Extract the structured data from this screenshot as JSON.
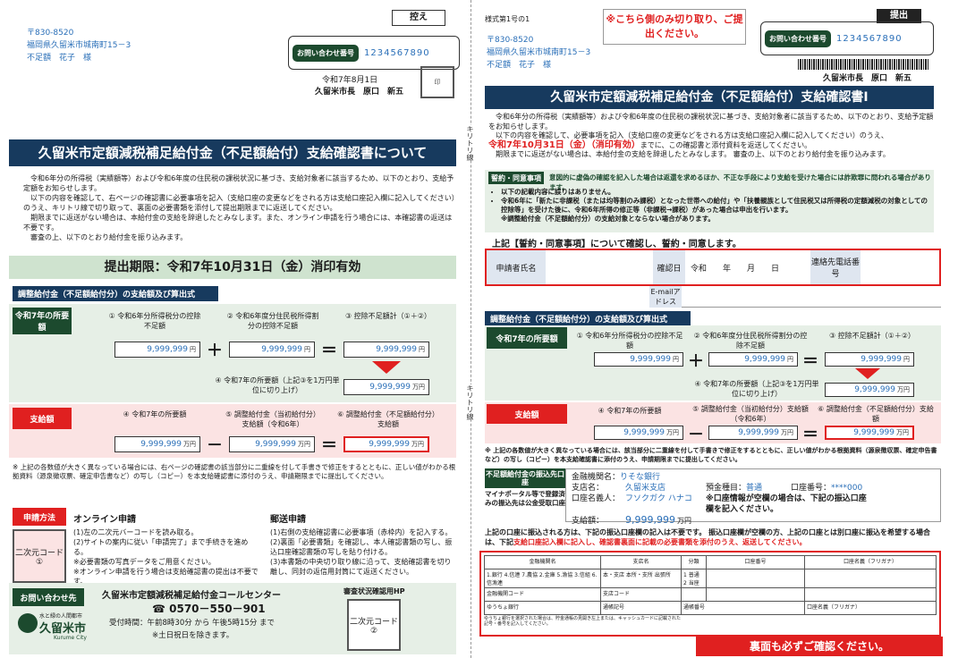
{
  "left": {
    "keep_label": "控え",
    "address": [
      "〒830-8520",
      "福岡県久留米市城南町15－3",
      "不足額　花子　様"
    ],
    "contact_label": "お問い合わせ番号",
    "contact_number": "1234567890",
    "date": "令和7年8月1日",
    "mayor": "久留米市長　原口　新五",
    "title": "久留米市定額減税補足給付金（不足額給付）支給確認書について",
    "intro": [
      "令和6年分の所得税（実績額等）および令和6年度の住民税の課税状況に基づき、支給対象者に該当するため、以下のとおり、支給予定額をお知らせします。",
      "以下の内容を確認して、右ページの確認書に必要事項を記入（支給口座の変更などをされる方は支給口座記入欄に記入してください）のうえ、キリトリ線で切り取って、裏面の必要書類を添付して提出期限までに返送してください。",
      "期限までに返送がない場合は、本給付金の支給を辞退したとみなします。また、オンライン申請を行う場合には、本確認書の返送は不要です。",
      "審査の上、以下のとおり給付金を振り込みます。"
    ],
    "deadline": "提出期限：令和7年10月31日（金）消印有効",
    "calc_heading": "調整給付金（不足額給付分）の支給額及び算出式",
    "row1_label": "令和7年の所要額",
    "c1": "① 令和6年分所得税分の控除不足額",
    "c2": "② 令和6年度分住民税所得割分の控除不足額",
    "c3": "③ 控除不足額計（①＋②）",
    "v1": "9,999,999",
    "v2": "9,999,999",
    "v3": "9,999,999",
    "unit_yen": "円",
    "unit_man": "万円",
    "c4": "④ 令和7年の所要額（上記③を1万円単位に切り上げ）",
    "v4": "9,999,999",
    "row2_label": "支給額",
    "c5": "④ 令和7年の所要額",
    "c6": "⑤ 調整給付金（当初給付分）支給額（令和6年）",
    "c7": "⑥ 調整給付金（不足額給付分）支給額",
    "v5": "9,999,999",
    "v6": "9,999,999",
    "v7": "9,999,999",
    "note": "※ 上記の各数値が大きく異なっている場合には、右ページの確認書の該当部分に二重線を付して手書きで修正をするとともに、正しい値がわかる根拠資料（源泉徴収票、確定申告書など）の写し（コピー）を本支給確認書に添付のうえ、申請期限までに提出してください。",
    "method_label": "申請方法",
    "online_title": "オンライン申請",
    "online_steps": [
      "(1)左の二次元バーコードを読み取る。",
      "(2)サイトの案内に従い「申請完了」まで手続きを進める。",
      "※必要書類の写真データをご用意ください。",
      "※オンライン申請を行う場合は支給確認書の提出は不要です。"
    ],
    "mail_title": "郵送申請",
    "mail_steps": [
      "(1)右側の支給確認書に必要事項（赤枠内）を記入する。",
      "(2)裏面「必要書類」を確認し、本人確認書類の写し、振込口座確認書類の写しを貼り付ける。",
      "(3)本書類の中央切り取り線に沿って、支給確認書を切り離し、同封の返信用封筒にて返送ください。"
    ],
    "qr1": "二次元コード①",
    "inquiry_label": "お問い合わせ先",
    "call_center": "久留米市定額減税補足給付金コールセンター",
    "phone": "☎ 0570－550－901",
    "hours": "受付時間：午前8時30分 から 午後5時15分 まで",
    "holidays": "※土日祝日を除きます。",
    "hp_label": "審査状況確認用HP",
    "qr2": "二次元コード②",
    "city_slogan": "水と緑の人間都市",
    "city_name": "久留米市",
    "city_en": "Kurume City"
  },
  "cut_line": "キリトリ線",
  "right": {
    "form_no": "様式第1号の1",
    "cut_notice": "※こちら側のみ切り取り、ご提出ください。",
    "submit_label": "提出",
    "address": [
      "〒830-8520",
      "福岡県久留米市城南町15－3",
      "不足額　花子　様"
    ],
    "contact_label": "お問い合わせ番号",
    "contact_number": "1234567890",
    "mayor": "久留米市長　原口　新五",
    "title": "久留米市定額減税補足給付金（不足額給付）支給確認書Ⅰ",
    "intro1": "令和6年分の所得税（実績額等）および令和6年度の住民税の課税状況に基づき、支給対象者に該当するため、以下のとおり、支給予定額をお知らせします。",
    "intro2": "以下の内容を確認して、必要事項を記入（支給口座の変更などをされる方は支給口座記入欄に記入してください）のうえ、",
    "intro3_red": "令和7年10月31日（金）（消印有効）",
    "intro3_rest": "までに、この確認書と添付資料を返送してください。",
    "intro4": "期限までに返送がない場合は、本給付金の支給を辞退したとみなします。 審査の上、以下のとおり給付金を振り込みます。",
    "oath_label": "誓約・同意事項",
    "oath_head": "意図的に虚偽の確認を記入した場合は返還を求めるほか、不正な手段により支給を受けた場合には詐欺罪に問われる場合があります。",
    "oath_items": [
      "以下の記載内容に誤りはありません。",
      "令和6年に「新たに非課税（または均等割のみ課税）となった世帯への給付」や「扶養親族として住民税又は所得税の定額減税の対象としての控除等」を受けた後に、令和6年所得の修正等（非課税→課税）があった場合は申出を行います。",
      "※調整給付金（不足額給付分）の支給対象とならない場合があります。"
    ],
    "agree": "上記【誓約・同意事項】について確認し、誓約・同意します。",
    "applicant_label": "申請者氏名",
    "confirm_date_label": "確認日",
    "date_fields": "令和　　年　　月　　日",
    "phone_label": "連絡先電話番号",
    "email_label": "E-mailアドレス",
    "calc_heading": "調整給付金（不足額給付分）の支給額及び算出式",
    "row1_label": "令和7年の所要額",
    "c1": "① 令和6年分所得税分の控除不足額",
    "c2": "② 令和6年度分住民税所得割分の控除不足額",
    "c3": "③ 控除不足額計（①＋②）",
    "v1": "9,999,999",
    "v2": "9,999,999",
    "v3": "9,999,999",
    "unit_yen": "円",
    "unit_man": "万円",
    "c4": "④ 令和7年の所要額（上記③を1万円単位に切り上げ）",
    "v4": "9,999,999",
    "row2_label": "支給額",
    "c5": "④ 令和7年の所要額",
    "c6": "⑤ 調整給付金（当初給付分）支給額（令和6年）",
    "c7": "⑥ 調整給付金（不足額給付分）支給額",
    "v5": "9,999,999",
    "v6": "9,999,999",
    "v7": "9,999,999",
    "note": "※ 上記の各数値が大きく異なっている場合には、該当部分に二重線を付して手書きで修正をするとともに、正しい値がわかる根拠資料（源泉徴収票、確定申告書など）の写し（コピー）を本支給確認書に添付のうえ、申請期限までに提出してください。",
    "bank_label": "不足額給付金の振込先口座",
    "bank_sub": "マイナポータル等で登録済みの振込先は公金受取口座",
    "bank_name_lbl": "金融機関名：",
    "bank_name": "りそな銀行",
    "branch_lbl": "支店名：",
    "branch": "久留米支店",
    "type_lbl": "預金種目：",
    "type": "普通",
    "acct_lbl": "口座番号：",
    "acct": "****000",
    "holder_lbl": "口座名義人：",
    "holder": "フソクガク ハナコ",
    "amount_lbl": "支給額：",
    "amount": "9,999,999",
    "amount_unit": "万円",
    "bank_note": "※口座情報が空欄の場合は、下記の振込口座欄を記入ください。",
    "transfer_note_black": "上記の口座に振込される方は、下記の振込口座欄の記入は不要です。 振込口座欄が空欄の方、上記の口座とは別口座に振込を希望する場合は、下記",
    "transfer_note_red": "支給口座記入欄に記入し、確認書裏面に記載の必要書類を添付のうえ、返送してください。",
    "table_h": [
      "金融機関名",
      "支店名",
      "分類",
      "口座番号",
      "口座名義（フリガナ）"
    ],
    "bank_types": "1.銀行 4.信連 7.農協 2.金庫 5.漁協 3.信組 6.信漁連",
    "branch_types": "本・支店 本所・支所 出張所",
    "acct_types": "1 普通 2 当座",
    "code_lbl": "金融機関コード",
    "branch_code_lbl": "支店コード",
    "yucho_lbl": "ゆうちょ銀行",
    "yucho_sub": "ゆうちょ銀行を選択された場合は、貯金通帳の見開き左上または、キャッシュカードに記載された記号・番号を記入してください。",
    "tsucho_kigo": "通帳記号",
    "tsucho_bango": "通帳番号",
    "holder_kana": "口座名義（フリガナ）",
    "back_notice": "裏面も必ずご確認ください。"
  }
}
